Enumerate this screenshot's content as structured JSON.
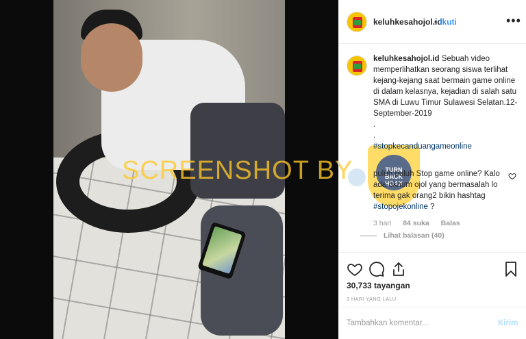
{
  "post": {
    "username": "keluhkesahojol.id",
    "follow_label": "Ikuti",
    "more_label": "•••"
  },
  "caption": {
    "username": "keluhkesahojol.id",
    "text": "Sebuah video memperlihatkan seorang siswa terlihat kejang-kejang saat bermain game online di dalam kelasnya, kejadian di salah satu SMA di Luwu Timur Sulawesi Selatan.12-September-2019\n.\n.",
    "hashtag": "#stopkecanduangameonline"
  },
  "comment": {
    "text": "puluh puluh Stop game online? Kalo ada oknum ojol yang bermasalah lo terima gak orang2 bikin hashtag ",
    "hashtag": "#stopojekonline",
    "suffix": " ?",
    "time": "3 hari",
    "likes": "84 suka",
    "reply_label": "Balas",
    "view_replies": "Lihat balasan (40)"
  },
  "stats": {
    "views": "30,733 tayangan",
    "time_ago": "3 HARI YANG LALU"
  },
  "composer": {
    "placeholder": "Tambahkan komentar...",
    "send_label": "Kirim"
  },
  "overlay": {
    "watermark": "SCREENSHOT BY",
    "seal_text": "TURN BACK HOAX"
  },
  "colors": {
    "link": "#3897f0",
    "hashtag": "#003569",
    "muted": "#999999",
    "watermark": "#ffc828"
  },
  "icons": [
    "more-icon",
    "heart-icon",
    "comment-icon",
    "share-icon",
    "bookmark-icon"
  ]
}
